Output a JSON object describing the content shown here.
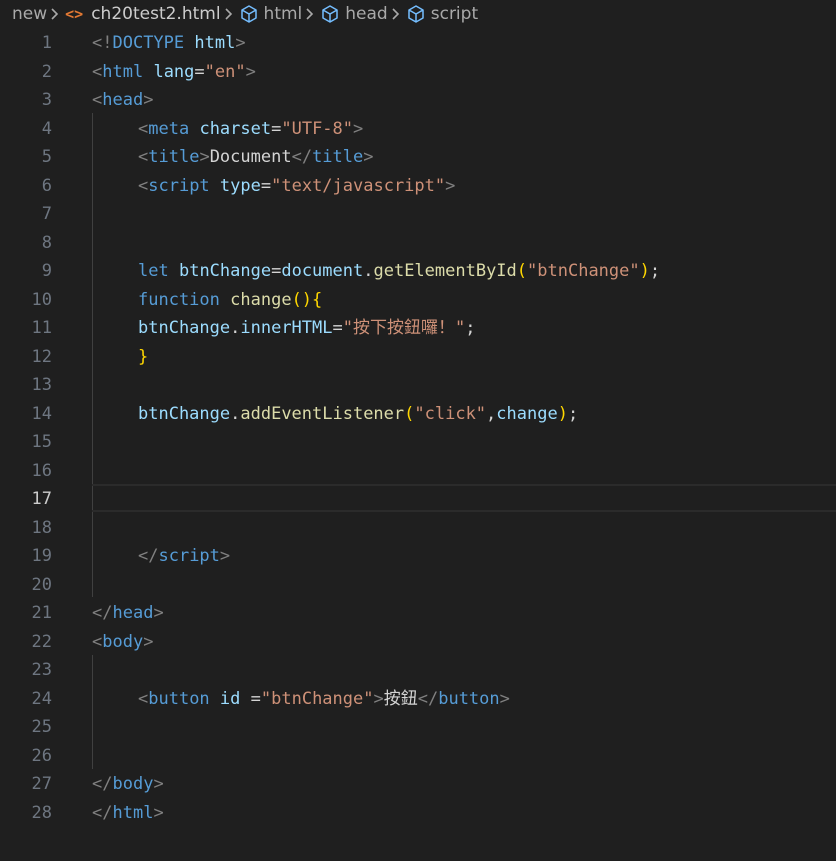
{
  "breadcrumb": {
    "folder": "new",
    "file": "ch20test2.html",
    "items": [
      "html",
      "head",
      "script"
    ]
  },
  "colors": {
    "background": "#1f1f1f",
    "tag": "#569cd6",
    "attribute": "#9cdcfe",
    "string": "#ce9178",
    "function": "#dcdcaa",
    "bracket": "#ffd700",
    "punctuation": "#808080",
    "line_number": "#6e7681"
  },
  "editor": {
    "active_line": 17,
    "line_numbers": [
      "1",
      "2",
      "3",
      "4",
      "5",
      "6",
      "7",
      "8",
      "9",
      "10",
      "11",
      "12",
      "13",
      "14",
      "15",
      "16",
      "17",
      "18",
      "19",
      "20",
      "21",
      "22",
      "23",
      "24",
      "25",
      "26",
      "27",
      "28"
    ],
    "lines": [
      {
        "tokens": [
          [
            "pu",
            "<!"
          ],
          [
            "tg",
            "DOCTYPE"
          ],
          [
            "tx",
            " "
          ],
          [
            "at",
            "html"
          ],
          [
            "pu",
            ">"
          ]
        ]
      },
      {
        "tokens": [
          [
            "pu",
            "<"
          ],
          [
            "tg",
            "html"
          ],
          [
            "tx",
            " "
          ],
          [
            "at",
            "lang"
          ],
          [
            "tx",
            "="
          ],
          [
            "st",
            "\"en\""
          ],
          [
            "pu",
            ">"
          ]
        ]
      },
      {
        "tokens": [
          [
            "pu",
            "<"
          ],
          [
            "tg",
            "head"
          ],
          [
            "pu",
            ">"
          ]
        ]
      },
      {
        "tokens": [
          [
            "pu",
            "<"
          ],
          [
            "tg",
            "meta"
          ],
          [
            "tx",
            " "
          ],
          [
            "at",
            "charset"
          ],
          [
            "tx",
            "="
          ],
          [
            "st",
            "\"UTF-8\""
          ],
          [
            "pu",
            ">"
          ]
        ]
      },
      {
        "tokens": [
          [
            "pu",
            "<"
          ],
          [
            "tg",
            "title"
          ],
          [
            "pu",
            ">"
          ],
          [
            "tx",
            "Document"
          ],
          [
            "pu",
            "</"
          ],
          [
            "tg",
            "title"
          ],
          [
            "pu",
            ">"
          ]
        ]
      },
      {
        "tokens": [
          [
            "pu",
            "<"
          ],
          [
            "tg",
            "script"
          ],
          [
            "tx",
            " "
          ],
          [
            "at",
            "type"
          ],
          [
            "tx",
            "="
          ],
          [
            "st",
            "\"text/javascript\""
          ],
          [
            "pu",
            ">"
          ]
        ]
      },
      {
        "tokens": []
      },
      {
        "tokens": []
      },
      {
        "tokens": [
          [
            "kw",
            "let"
          ],
          [
            "tx",
            " "
          ],
          [
            "va",
            "btnChange"
          ],
          [
            "tx",
            "="
          ],
          [
            "va",
            "document"
          ],
          [
            "tx",
            "."
          ],
          [
            "fn",
            "getElementById"
          ],
          [
            "br",
            "("
          ],
          [
            "st",
            "\"btnChange\""
          ],
          [
            "br",
            ")"
          ],
          [
            "tx",
            ";"
          ]
        ]
      },
      {
        "tokens": [
          [
            "kw",
            "function"
          ],
          [
            "tx",
            " "
          ],
          [
            "fn",
            "change"
          ],
          [
            "br",
            "(){"
          ]
        ]
      },
      {
        "tokens": [
          [
            "va",
            "btnChange"
          ],
          [
            "tx",
            "."
          ],
          [
            "va",
            "innerHTML"
          ],
          [
            "tx",
            "="
          ],
          [
            "st",
            "\"按下按鈕囉！\""
          ],
          [
            "tx",
            ";"
          ]
        ]
      },
      {
        "tokens": [
          [
            "br",
            "}"
          ]
        ]
      },
      {
        "tokens": []
      },
      {
        "tokens": [
          [
            "va",
            "btnChange"
          ],
          [
            "tx",
            "."
          ],
          [
            "fn",
            "addEventListener"
          ],
          [
            "br",
            "("
          ],
          [
            "st",
            "\"click\""
          ],
          [
            "tx",
            ","
          ],
          [
            "va",
            "change"
          ],
          [
            "br",
            ")"
          ],
          [
            "tx",
            ";"
          ]
        ]
      },
      {
        "tokens": []
      },
      {
        "tokens": []
      },
      {
        "tokens": []
      },
      {
        "tokens": []
      },
      {
        "tokens": [
          [
            "pu",
            "</"
          ],
          [
            "tg",
            "script"
          ],
          [
            "pu",
            ">"
          ]
        ]
      },
      {
        "tokens": []
      },
      {
        "tokens": [
          [
            "pu",
            "</"
          ],
          [
            "tg",
            "head"
          ],
          [
            "pu",
            ">"
          ]
        ]
      },
      {
        "tokens": [
          [
            "pu",
            "<"
          ],
          [
            "tg",
            "body"
          ],
          [
            "pu",
            ">"
          ]
        ]
      },
      {
        "tokens": []
      },
      {
        "tokens": [
          [
            "pu",
            "<"
          ],
          [
            "tg",
            "button"
          ],
          [
            "tx",
            " "
          ],
          [
            "at",
            "id"
          ],
          [
            "tx",
            " ="
          ],
          [
            "st",
            "\"btnChange\""
          ],
          [
            "pu",
            ">"
          ],
          [
            "tx",
            "按鈕"
          ],
          [
            "pu",
            "</"
          ],
          [
            "tg",
            "button"
          ],
          [
            "pu",
            ">"
          ]
        ]
      },
      {
        "tokens": []
      },
      {
        "tokens": []
      },
      {
        "tokens": [
          [
            "pu",
            "</"
          ],
          [
            "tg",
            "body"
          ],
          [
            "pu",
            ">"
          ]
        ]
      },
      {
        "tokens": [
          [
            "pu",
            "</"
          ],
          [
            "tg",
            "html"
          ],
          [
            "pu",
            ">"
          ]
        ]
      }
    ]
  }
}
